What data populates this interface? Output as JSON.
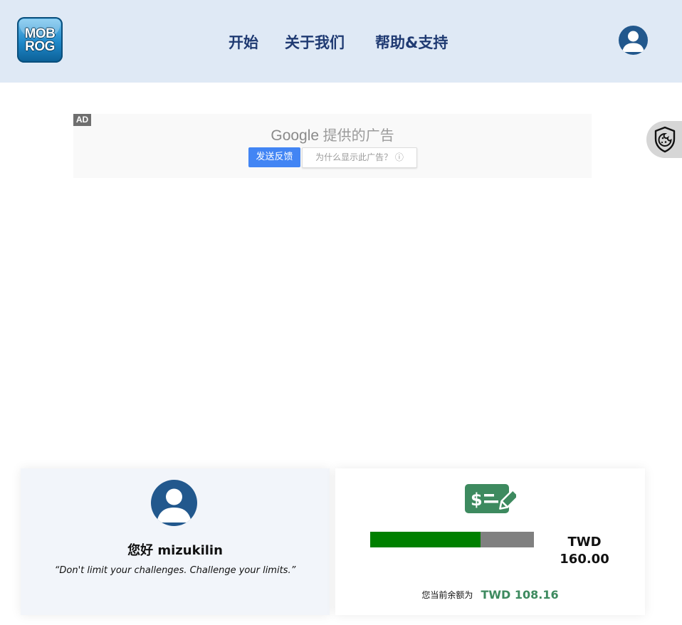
{
  "header": {
    "logo": {
      "line1": "MOB",
      "line2": "ROG"
    },
    "nav": [
      {
        "label": "开始"
      },
      {
        "label": "关于我们"
      },
      {
        "label": "帮助&支持"
      }
    ],
    "user_icon": "user-avatar-icon"
  },
  "ad": {
    "badge": "AD",
    "brand": "Google",
    "title_suffix": " 提供的广告",
    "feedback_button": "发送反馈",
    "why_button": "为什么显示此广告？ ⓘ"
  },
  "cookie_icon": "cookie-shield-icon",
  "profile": {
    "greeting": "您好 mizukilin",
    "quote": "“Don't limit your challenges. Challenge your limits.”",
    "avatar_icon": "user-avatar-icon"
  },
  "wallet": {
    "icon": "money-check-edit-icon",
    "limit_currency": "TWD",
    "limit_amount": "160.00",
    "used_fraction": 0.676,
    "balance_label": "您当前余额为",
    "balance_value": "TWD 108.16",
    "colors": {
      "bar_fill": "#008000",
      "bar_track": "#808080",
      "balance": "#3d8a5f",
      "icon": "#3d8a5f"
    }
  }
}
